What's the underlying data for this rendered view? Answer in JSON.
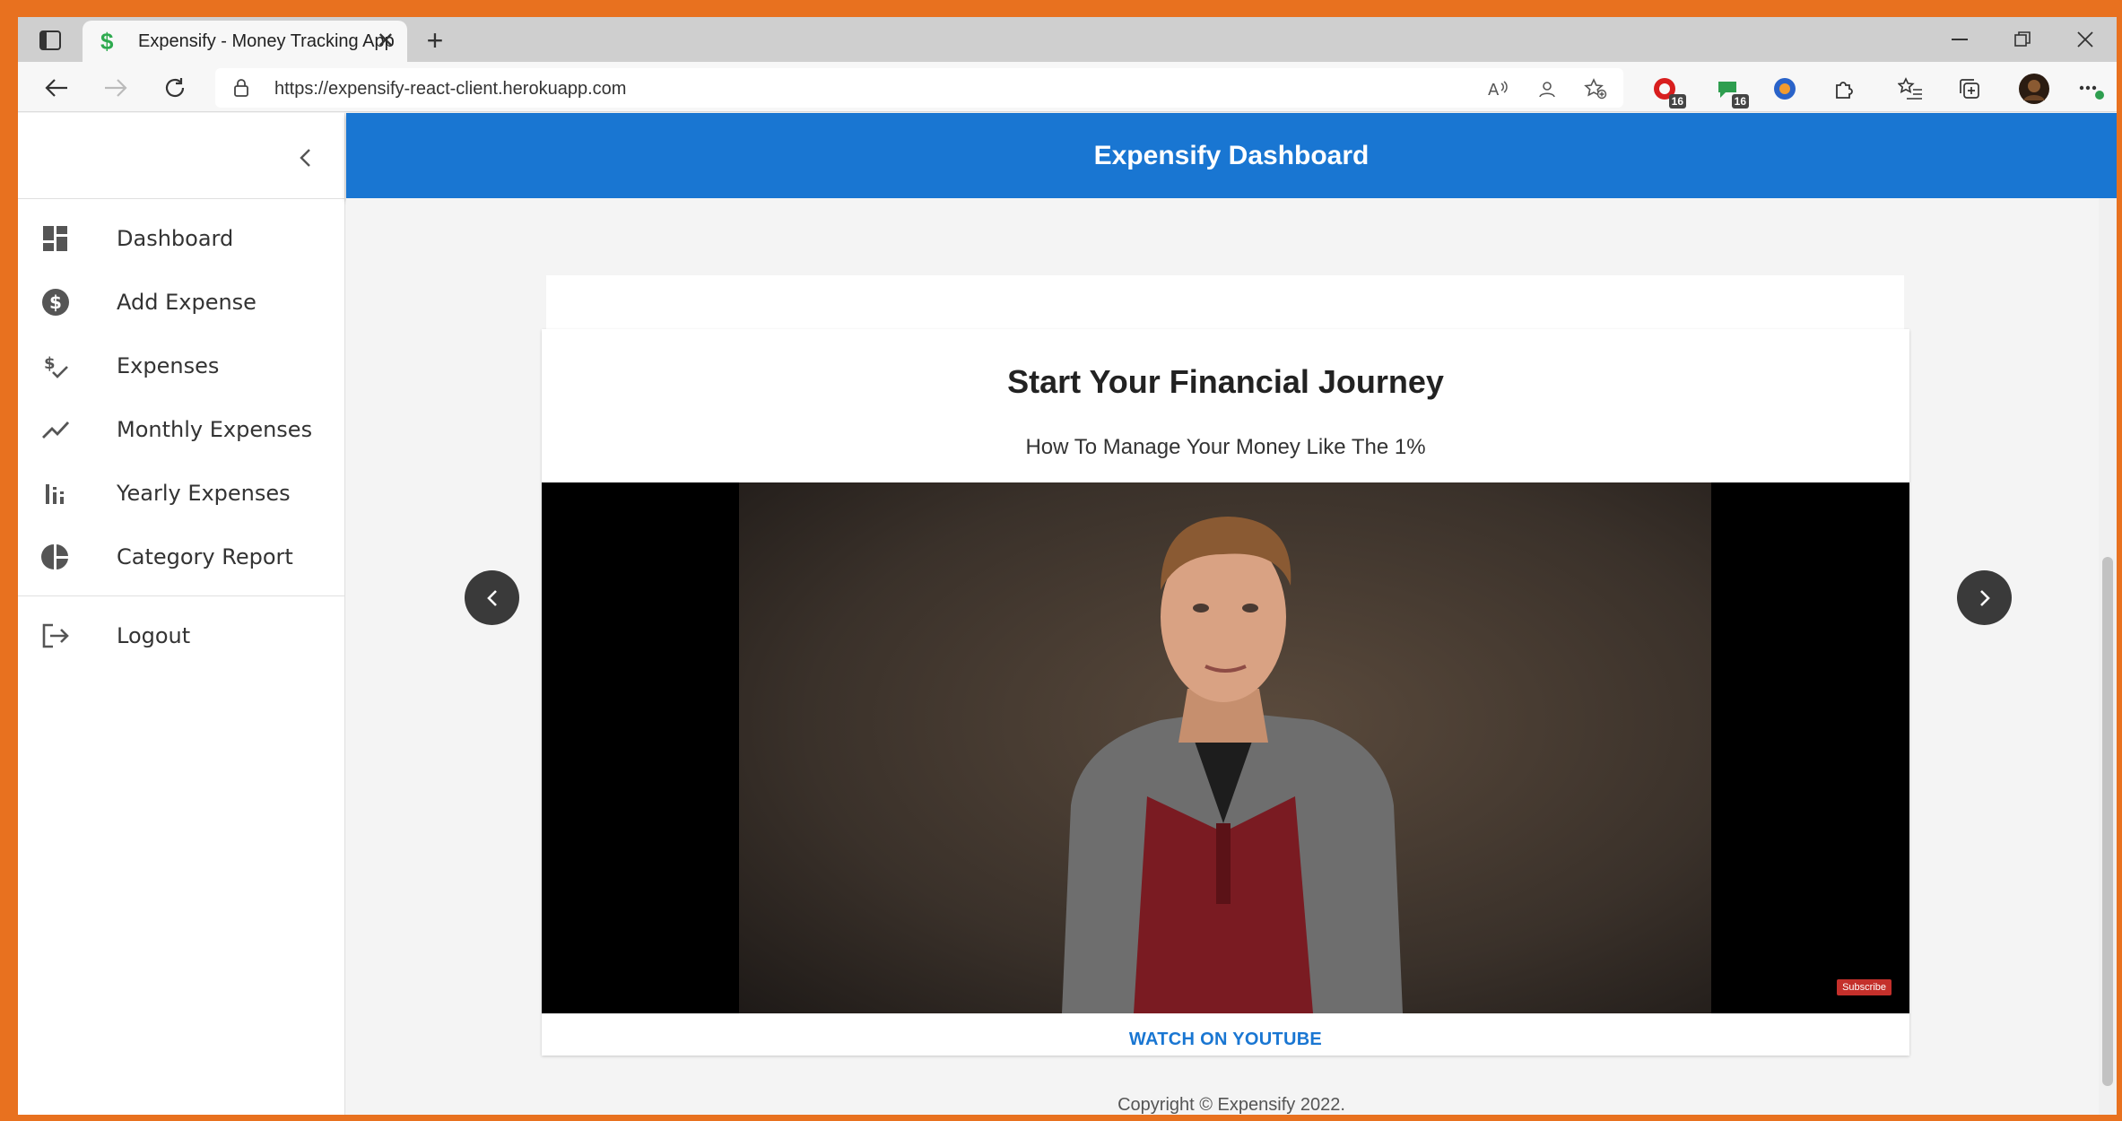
{
  "browser": {
    "tab_title": "Expensify - Money Tracking App",
    "tab_favicon": "$",
    "url": "https://expensify-react-client.herokuapp.com",
    "extension_badges": [
      "16",
      "16"
    ]
  },
  "app": {
    "header_title": "Expensify Dashboard",
    "sidebar": {
      "items": [
        {
          "label": "Dashboard",
          "icon": "dashboard-icon"
        },
        {
          "label": "Add Expense",
          "icon": "dollar-circle-icon"
        },
        {
          "label": "Expenses",
          "icon": "expense-check-icon"
        },
        {
          "label": "Monthly Expenses",
          "icon": "trending-line-icon"
        },
        {
          "label": "Yearly Expenses",
          "icon": "bar-chart-icon"
        },
        {
          "label": "Category Report",
          "icon": "pie-chart-icon"
        }
      ],
      "logout_label": "Logout"
    },
    "carousel": {
      "title": "Start Your Financial Journey",
      "subtitle": "How To Manage Your Money Like The 1%",
      "subscribe_label": "Subscribe",
      "action_label": "WATCH ON YOUTUBE"
    },
    "footer": "Copyright © Expensify 2022."
  },
  "colors": {
    "brand_blue": "#1976d2",
    "window_border": "#e8711f"
  }
}
